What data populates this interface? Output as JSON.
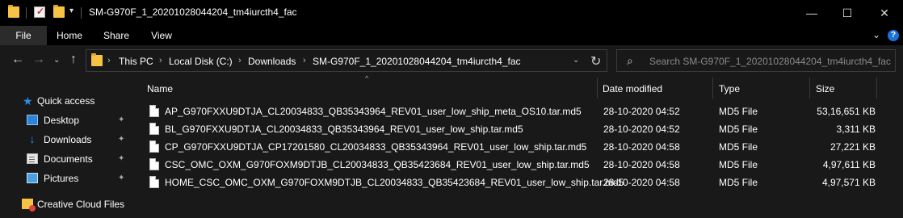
{
  "window": {
    "title": "SM-G970F_1_20201028044204_tm4iurcth4_fac",
    "minimize_glyph": "—",
    "maximize_glyph": "☐",
    "close_glyph": "✕"
  },
  "ribbon": {
    "tabs": [
      {
        "label": "File"
      },
      {
        "label": "Home"
      },
      {
        "label": "Share"
      },
      {
        "label": "View"
      }
    ],
    "collapse_glyph": "⌄",
    "help_glyph": "?"
  },
  "nav": {
    "back_glyph": "←",
    "forward_glyph": "→",
    "recent_glyph": "⌄",
    "up_glyph": "↑",
    "breadcrumb": [
      "This PC",
      "Local Disk (C:)",
      "Downloads",
      "SM-G970F_1_20201028044204_tm4iurcth4_fac"
    ],
    "chevron_glyph": "›",
    "dropdown_glyph": "⌄",
    "refresh_glyph": "↻",
    "search_glyph": "⌕",
    "search_placeholder": "Search SM-G970F_1_20201028044204_tm4iurcth4_fac"
  },
  "sidebar": {
    "items": [
      {
        "label": "Quick access",
        "icon": "star-icon"
      },
      {
        "label": "Desktop",
        "icon": "desktop-icon",
        "pinned": true
      },
      {
        "label": "Downloads",
        "icon": "download-icon",
        "pinned": true
      },
      {
        "label": "Documents",
        "icon": "documents-icon",
        "pinned": true
      },
      {
        "label": "Pictures",
        "icon": "pictures-icon",
        "pinned": true
      },
      {
        "label": "Creative Cloud Files",
        "icon": "creative-cloud-icon"
      }
    ],
    "pin_glyph": "📌",
    "star_glyph": "★",
    "download_glyph": "↓"
  },
  "columns": {
    "name": "Name",
    "date": "Date modified",
    "type": "Type",
    "size": "Size",
    "sort_glyph": "^"
  },
  "files": [
    {
      "name": "AP_G970FXXU9DTJA_CL20034833_QB35343964_REV01_user_low_ship_meta_OS10.tar.md5",
      "date": "28-10-2020 04:52",
      "type": "MD5 File",
      "size": "53,16,651 KB"
    },
    {
      "name": "BL_G970FXXU9DTJA_CL20034833_QB35343964_REV01_user_low_ship.tar.md5",
      "date": "28-10-2020 04:52",
      "type": "MD5 File",
      "size": "3,311 KB"
    },
    {
      "name": "CP_G970FXXU9DTJA_CP17201580_CL20034833_QB35343964_REV01_user_low_ship.tar.md5",
      "date": "28-10-2020 04:58",
      "type": "MD5 File",
      "size": "27,221 KB"
    },
    {
      "name": "CSC_OMC_OXM_G970FOXM9DTJB_CL20034833_QB35423684_REV01_user_low_ship.tar.md5",
      "date": "28-10-2020 04:58",
      "type": "MD5 File",
      "size": "4,97,611 KB"
    },
    {
      "name": "HOME_CSC_OMC_OXM_G970FOXM9DTJB_CL20034833_QB35423684_REV01_user_low_ship.tar.md5",
      "date": "28-10-2020 04:58",
      "type": "MD5 File",
      "size": "4,97,571 KB"
    }
  ],
  "colors": {
    "background": "#191919",
    "titlebar": "#000000",
    "accent": "#2b8ee6",
    "folder": "#f6c444"
  }
}
